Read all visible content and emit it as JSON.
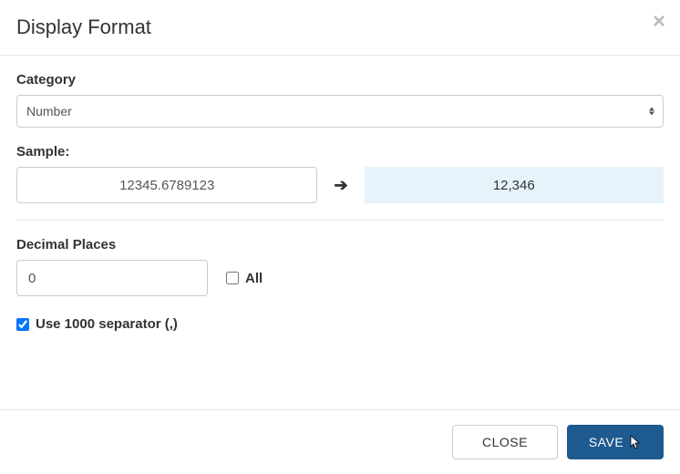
{
  "header": {
    "title": "Display Format"
  },
  "category": {
    "label": "Category",
    "value": "Number"
  },
  "sample": {
    "label": "Sample:",
    "input_value": "12345.6789123",
    "output_value": "12,346"
  },
  "decimal": {
    "label": "Decimal Places",
    "value": "0",
    "all_label": "All",
    "all_checked": false
  },
  "separator": {
    "label": "Use 1000 separator (,)",
    "checked": true
  },
  "footer": {
    "close_label": "CLOSE",
    "save_label": "SAVE"
  }
}
